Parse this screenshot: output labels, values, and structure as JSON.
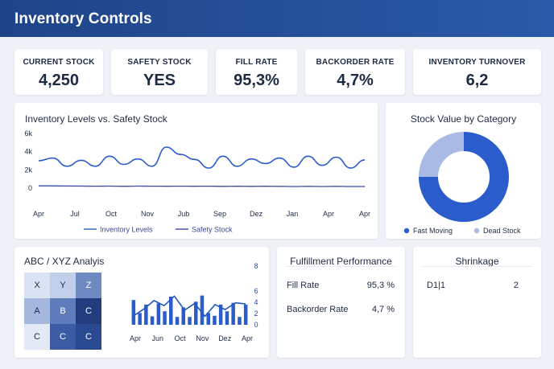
{
  "header": {
    "title": "Inventory Controls"
  },
  "kpis": [
    {
      "label": "CURRENT STOCK",
      "value": "4,250"
    },
    {
      "label": "SAFETY STOCK",
      "value": "YES"
    },
    {
      "label": "FILL RATE",
      "value": "95,3%"
    },
    {
      "label": "BACKORDER RATE",
      "value": "4,7%"
    },
    {
      "label": "INVENTORY TURNOVER",
      "value": "6,2"
    }
  ],
  "levels": {
    "title": "Inventory Levels vs. Safety Stock"
  },
  "stock_value": {
    "title": "Stock Value by Category"
  },
  "abc": {
    "title": "ABC / XYZ Analyis",
    "matrix": [
      [
        "X",
        "Y",
        "Z"
      ],
      [
        "A",
        "B",
        "C"
      ],
      [
        "C",
        "C",
        "C"
      ]
    ],
    "matrix_colors": [
      [
        "#dbe3f3",
        "#c2cfe9",
        "#6f8ac3"
      ],
      [
        "#a6b8de",
        "#5f7dbd",
        "#223c7d"
      ],
      [
        "#e3e9f6",
        "#3b5ba4",
        "#294a91"
      ]
    ],
    "matrix_text_colors": [
      [
        "#1d2a44",
        "#1d2a44",
        "#ffffff"
      ],
      [
        "#1d2a44",
        "#ffffff",
        "#ffffff"
      ],
      [
        "#1d2a44",
        "#ffffff",
        "#ffffff"
      ]
    ]
  },
  "fulfillment": {
    "title": "Fulfillment Performance",
    "rows": [
      {
        "label": "Fill Rate",
        "value": "95,3 %"
      },
      {
        "label": "Backorder Rate",
        "value": "4,7 %"
      }
    ]
  },
  "shrinkage": {
    "title": "Shrinkage",
    "row": {
      "label": "D1|1",
      "value": "2"
    }
  },
  "colors": {
    "header": "#234a92",
    "primary": "#2a5ccb",
    "light": "#a9bbe4",
    "safety": "#3a4aa0"
  },
  "chart_data": [
    {
      "type": "line",
      "title": "Inventory Levels vs. Safety Stock",
      "x": [
        "Apr",
        "Jul",
        "Oct",
        "Nov",
        "Jub",
        "Sep",
        "Dez",
        "Jan",
        "Apr",
        "Apr"
      ],
      "yticks": [
        "6k",
        "4k",
        "2k",
        "0"
      ],
      "ylim": [
        0,
        6000
      ],
      "series": [
        {
          "name": "Inventory Levels",
          "values": [
            3000,
            3300,
            2400,
            3050,
            2400,
            3500,
            2600,
            3200,
            2400,
            4500,
            3700,
            3150,
            2200,
            3500,
            2400,
            3200,
            2700,
            3300,
            2300,
            3500,
            2500,
            3400,
            2200,
            3100
          ]
        },
        {
          "name": "Safety Stock",
          "values": [
            250,
            250,
            230,
            220,
            210,
            220,
            200,
            220,
            210,
            200,
            210,
            200,
            210,
            190,
            200,
            190,
            200,
            190,
            180,
            190,
            180,
            190,
            180,
            180
          ]
        }
      ],
      "grid": false,
      "legend": "bottom"
    },
    {
      "type": "pie",
      "title": "Stock Value by Category",
      "categories": [
        "Fast Moving",
        "Dead Stock"
      ],
      "values": [
        75,
        25
      ],
      "colors": [
        "#2a5ccb",
        "#a9bbe4"
      ],
      "legend": "bottom"
    },
    {
      "type": "bar",
      "title": "",
      "x": [
        "Apr",
        "Jun",
        "Oct",
        "Nov",
        "Dez",
        "Apr"
      ],
      "yticks": [
        "8",
        "6",
        "4",
        "2",
        "0"
      ],
      "ylim": [
        0,
        8
      ],
      "series": [
        {
          "name": "",
          "values": [
            4.4,
            2.1,
            3.6,
            1.5,
            3.8,
            2.4,
            5.0,
            1.4,
            3.1,
            1.4,
            4.1,
            5.2,
            2.1,
            1.6,
            3.6,
            2.4,
            3.9,
            1.4,
            3.6
          ]
        }
      ],
      "line_values": [
        1.6,
        2.8,
        4.3,
        3.4,
        5.1,
        2.6,
        3.8,
        1.5,
        3.6,
        2.7,
        3.9,
        3.7
      ]
    }
  ]
}
